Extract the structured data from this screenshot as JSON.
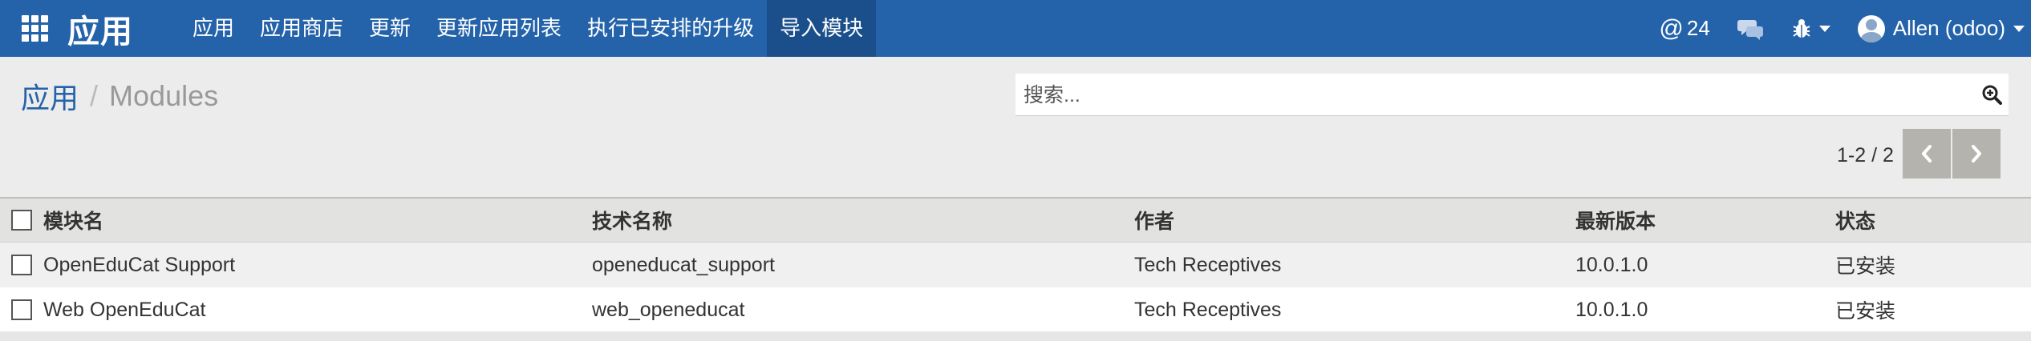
{
  "navbar": {
    "brand": "应用",
    "menu": [
      "应用",
      "应用商店",
      "更新",
      "更新应用列表",
      "执行已安排的升级",
      "导入模块"
    ],
    "active_menu": "导入模块",
    "mention_count": "24",
    "user": "Allen (odoo)",
    "icons": [
      "apps-grid-icon",
      "at-icon",
      "chat-icon",
      "bug-icon",
      "avatar"
    ]
  },
  "breadcrumb": {
    "parent": "应用",
    "separator": "/",
    "current": "Modules"
  },
  "search": {
    "placeholder": "搜索...",
    "value": ""
  },
  "pager": {
    "value": "1-2 / 2"
  },
  "table": {
    "columns": [
      "模块名",
      "技术名称",
      "作者",
      "最新版本",
      "状态"
    ],
    "rows": [
      [
        "OpenEduCat Support",
        "openeducat_support",
        "Tech Receptives",
        "10.0.1.0",
        "已安装"
      ],
      [
        "Web OpenEduCat",
        "web_openeducat",
        "Tech Receptives",
        "10.0.1.0",
        "已安装"
      ]
    ]
  },
  "colors": {
    "navbar": "#2463aa",
    "navbar_active": "#1a4f8c",
    "link": "#2463aa",
    "pager_button": "#b5b3ae"
  }
}
